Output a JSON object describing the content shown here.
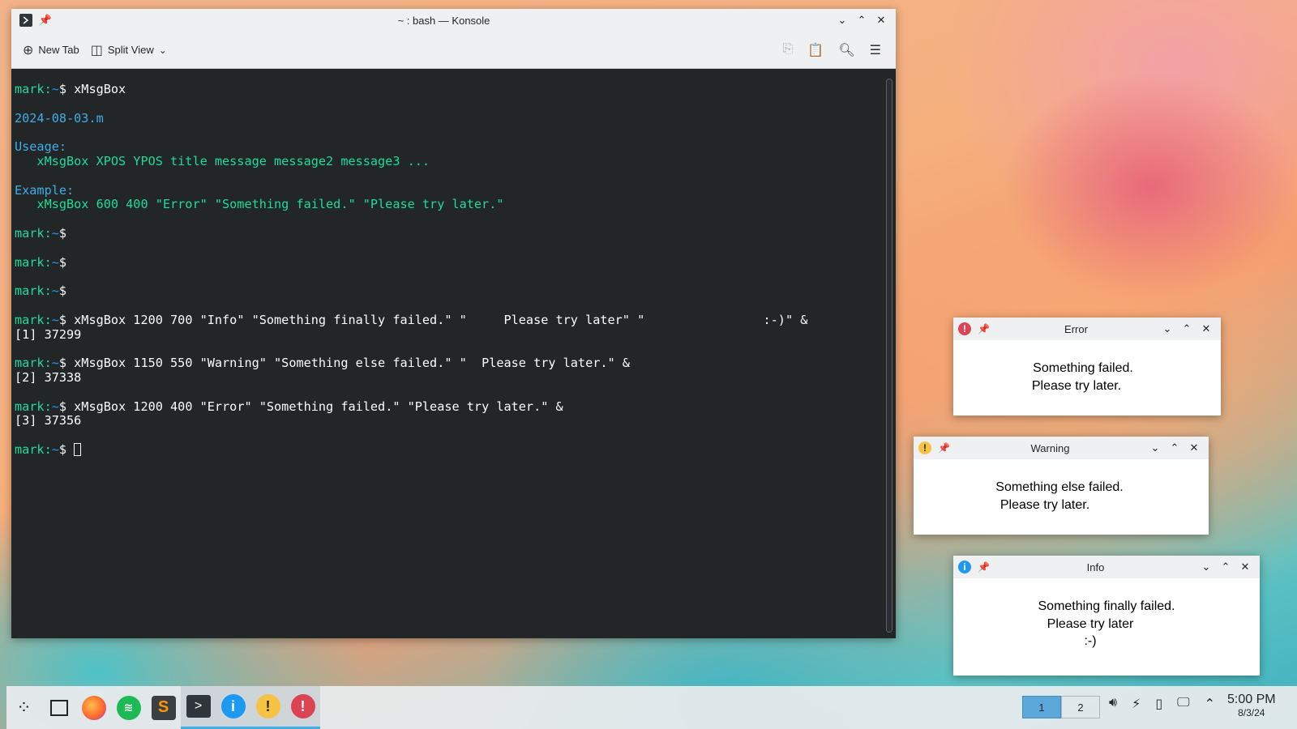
{
  "konsole": {
    "title": "~ : bash — Konsole",
    "toolbar": {
      "new_tab": "New Tab",
      "split_view": "Split View"
    },
    "lines": [
      {
        "segments": [
          {
            "c": "g",
            "t": "mark:"
          },
          {
            "c": "b",
            "t": "~"
          },
          {
            "c": "",
            "t": "$ xMsgBox"
          }
        ]
      },
      {
        "segments": []
      },
      {
        "segments": [
          {
            "c": "blue2",
            "t": "2024-08-03.m"
          }
        ]
      },
      {
        "segments": []
      },
      {
        "segments": [
          {
            "c": "blue2",
            "t": "Useage:"
          }
        ]
      },
      {
        "segments": [
          {
            "c": "g",
            "t": "   xMsgBox XPOS YPOS title message message2 message3 ..."
          }
        ]
      },
      {
        "segments": []
      },
      {
        "segments": [
          {
            "c": "blue2",
            "t": "Example:"
          }
        ]
      },
      {
        "segments": [
          {
            "c": "g",
            "t": "   xMsgBox 600 400 \"Error\" \"Something failed.\" \"Please try later.\""
          }
        ]
      },
      {
        "segments": []
      },
      {
        "segments": [
          {
            "c": "g",
            "t": "mark:"
          },
          {
            "c": "b",
            "t": "~"
          },
          {
            "c": "",
            "t": "$"
          }
        ]
      },
      {
        "segments": []
      },
      {
        "segments": [
          {
            "c": "g",
            "t": "mark:"
          },
          {
            "c": "b",
            "t": "~"
          },
          {
            "c": "",
            "t": "$"
          }
        ]
      },
      {
        "segments": []
      },
      {
        "segments": [
          {
            "c": "g",
            "t": "mark:"
          },
          {
            "c": "b",
            "t": "~"
          },
          {
            "c": "",
            "t": "$"
          }
        ]
      },
      {
        "segments": []
      },
      {
        "segments": [
          {
            "c": "g",
            "t": "mark:"
          },
          {
            "c": "b",
            "t": "~"
          },
          {
            "c": "",
            "t": "$ xMsgBox 1200 700 \"Info\" \"Something finally failed.\" \"     Please try later\" \"                :-)\" &"
          }
        ]
      },
      {
        "segments": [
          {
            "c": "",
            "t": "[1] 37299"
          }
        ]
      },
      {
        "segments": []
      },
      {
        "segments": [
          {
            "c": "g",
            "t": "mark:"
          },
          {
            "c": "b",
            "t": "~"
          },
          {
            "c": "",
            "t": "$ xMsgBox 1150 550 \"Warning\" \"Something else failed.\" \"  Please try later.\" &"
          }
        ]
      },
      {
        "segments": [
          {
            "c": "",
            "t": "[2] 37338"
          }
        ]
      },
      {
        "segments": []
      },
      {
        "segments": [
          {
            "c": "g",
            "t": "mark:"
          },
          {
            "c": "b",
            "t": "~"
          },
          {
            "c": "",
            "t": "$ xMsgBox 1200 400 \"Error\" \"Something failed.\" \"Please try later.\" &"
          }
        ]
      },
      {
        "segments": [
          {
            "c": "",
            "t": "[3] 37356"
          }
        ]
      },
      {
        "segments": []
      },
      {
        "segments": [
          {
            "c": "g",
            "t": "mark:"
          },
          {
            "c": "b",
            "t": "~"
          },
          {
            "c": "",
            "t": "$ "
          }
        ],
        "cursor": true
      }
    ]
  },
  "dialogs": {
    "error": {
      "title": "Error",
      "line1": "Something failed.",
      "line2": "Please try later.",
      "icon_color": "#da4453"
    },
    "warning": {
      "title": "Warning",
      "line1": "Something else failed.",
      "line2": "Please try later.",
      "icon_color": "#f6c342"
    },
    "info": {
      "title": "Info",
      "line1": "Something finally failed.",
      "line2": "Please try later",
      "line3": ":-)",
      "icon_color": "#1d99f3"
    }
  },
  "taskbar": {
    "apps": [
      "app-launcher-icon",
      "show-desktop-icon",
      "firefox-icon",
      "spotify-icon",
      "sublime-text-icon",
      "konsole-icon",
      "info-icon",
      "warning-icon",
      "error-icon"
    ],
    "pager": [
      "1",
      "2"
    ],
    "clock": {
      "time": "5:00 PM",
      "date": "8/3/24"
    }
  }
}
